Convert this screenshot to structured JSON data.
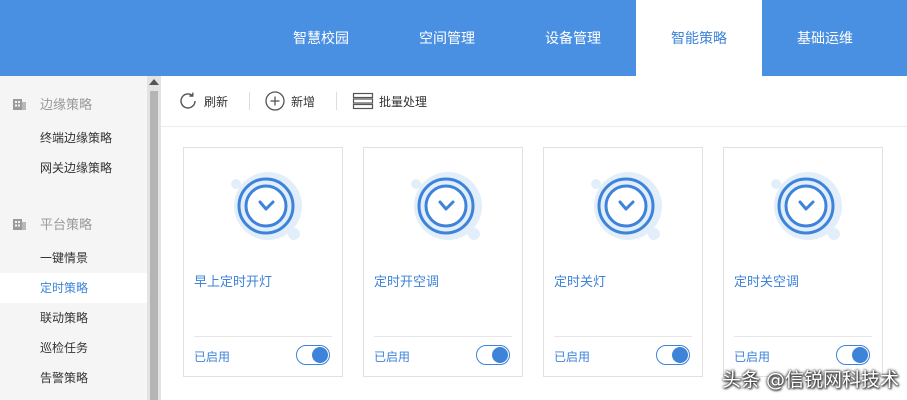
{
  "topnav": {
    "items": [
      {
        "label": "智慧校园"
      },
      {
        "label": "空间管理"
      },
      {
        "label": "设备管理"
      },
      {
        "label": "智能策略",
        "active": true
      },
      {
        "label": "基础运维"
      }
    ]
  },
  "sidebar": {
    "sections": [
      {
        "label": "边缘策略",
        "icon": "building-icon",
        "items": [
          {
            "label": "终端边缘策略"
          },
          {
            "label": "网关边缘策略"
          }
        ]
      },
      {
        "label": "平台策略",
        "icon": "building-icon",
        "items": [
          {
            "label": "一键情景"
          },
          {
            "label": "定时策略",
            "active": true
          },
          {
            "label": "联动策略"
          },
          {
            "label": "巡检任务"
          },
          {
            "label": "告警策略"
          }
        ]
      }
    ]
  },
  "toolbar": {
    "refresh_label": "刷新",
    "add_label": "新增",
    "batch_label": "批量处理"
  },
  "cards": [
    {
      "title": "早上定时开灯",
      "status": "已启用",
      "enabled": true
    },
    {
      "title": "定时开空调",
      "status": "已启用",
      "enabled": true
    },
    {
      "title": "定时关灯",
      "status": "已启用",
      "enabled": true
    },
    {
      "title": "定时关空调",
      "status": "已启用",
      "enabled": true
    }
  ],
  "watermark": "头条 @信锐网科技术",
  "colors": {
    "header": "#4a90e2",
    "accent": "#3d83d9",
    "sidebar_bg": "#f5f5f5"
  }
}
